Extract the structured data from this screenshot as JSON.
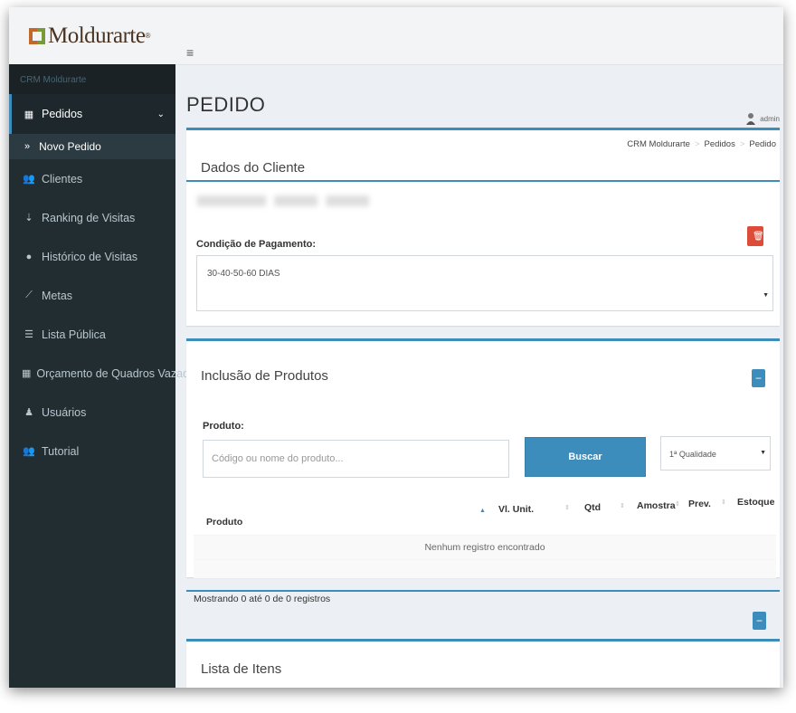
{
  "brand": {
    "name": "Moldurarte",
    "reg": "®"
  },
  "sidebar": {
    "header": "CRM Moldurarte",
    "items": [
      {
        "label": "Pedidos",
        "icon": "grid-icon"
      },
      {
        "label": "Clientes",
        "icon": "users-icon"
      },
      {
        "label": "Ranking de Visitas",
        "icon": "sort-icon"
      },
      {
        "label": "Histórico de Visitas",
        "icon": "map-marker-icon"
      },
      {
        "label": "Metas",
        "icon": "line-chart-icon"
      },
      {
        "label": "Lista Pública",
        "icon": "list-icon"
      },
      {
        "label": "Orçamento de Quadros Vazados",
        "icon": "grid-icon"
      },
      {
        "label": "Usuários",
        "icon": "user-icon"
      },
      {
        "label": "Tutorial",
        "icon": "users-icon"
      }
    ],
    "sub_item": "Novo Pedido"
  },
  "header": {
    "menu_icon": "≡",
    "page_title": "PEDIDO",
    "user": "admin"
  },
  "breadcrumb": [
    "CRM Moldurarte",
    "Pedidos",
    "Pedido"
  ],
  "cliente": {
    "title": "Dados do Cliente",
    "pagamento_label": "Condição de Pagamento:",
    "pagamento_value": "30-40-50-60 DIAS"
  },
  "produtos": {
    "title": "Inclusão de Produtos",
    "produto_label": "Produto:",
    "search_placeholder": "Código ou nome do produto...",
    "buscar_label": "Buscar",
    "qualidade_value": "1ª Qualidade",
    "columns": [
      "Produto",
      "Vl. Unit.",
      "Qtd",
      "Amostra",
      "Prev.",
      "Estoque"
    ],
    "empty_text": "Nenhum registro encontrado",
    "info": "Mostrando 0 até 0 de 0 registros"
  },
  "itens": {
    "title": "Lista de Itens"
  },
  "colors": {
    "sidebar": "#222d32",
    "accent": "#3c8dbc",
    "danger": "#dd4b39"
  }
}
